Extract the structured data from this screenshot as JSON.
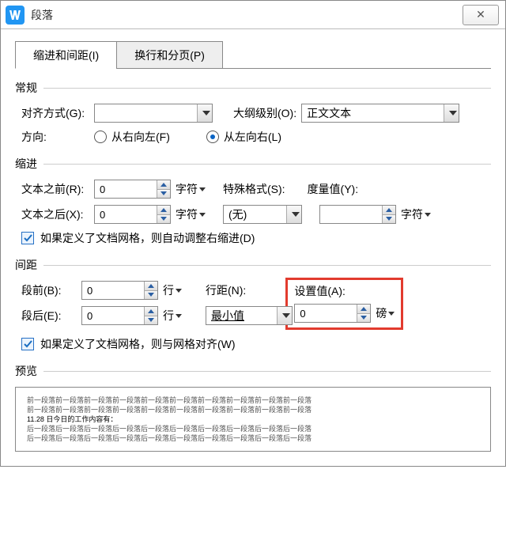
{
  "window": {
    "title": "段落",
    "close_glyph": "✕"
  },
  "tabs": {
    "indent": "缩进和间距(I)",
    "page": "换行和分页(P)"
  },
  "group": {
    "general": "常规",
    "indent": "缩进",
    "spacing": "间距",
    "preview": "预览"
  },
  "general": {
    "align_label": "对齐方式(G):",
    "align_value": "",
    "outline_label": "大纲级别(O):",
    "outline_value": "正文文本",
    "direction_label": "方向:",
    "rtl_label": "从右向左(F)",
    "ltr_label": "从左向右(L)"
  },
  "indent": {
    "before_label": "文本之前(R):",
    "before_value": "0",
    "after_label": "文本之后(X):",
    "after_value": "0",
    "unit_char": "字符",
    "special_label": "特殊格式(S):",
    "special_value": "(无)",
    "measure_label": "度量值(Y):",
    "measure_value": "",
    "check_label": "如果定义了文档网格，则自动调整右缩进(D)"
  },
  "spacing": {
    "before_label": "段前(B):",
    "before_value": "0",
    "after_label": "段后(E):",
    "after_value": "0",
    "unit_line": "行",
    "linespacing_label": "行距(N):",
    "linespacing_value": "最小值",
    "at_label": "设置值(A):",
    "at_value": "0",
    "at_unit": "磅",
    "check_label": "如果定义了文档网格，则与网格对齐(W)"
  },
  "preview_lines": {
    "l1": "前一段落前一段落前一段落前一段落前一段落前一段落前一段落前一段落前一段落前一段落",
    "l2": "前一段落前一段落前一段落前一段落前一段落前一段落前一段落前一段落前一段落前一段落",
    "l3": "11.28 日今日的工作内容有：",
    "l4": "后一段落后一段落后一段落后一段落后一段落后一段落后一段落后一段落后一段落后一段落",
    "l5": "后一段落后一段落后一段落后一段落后一段落后一段落后一段落后一段落后一段落后一段落"
  }
}
